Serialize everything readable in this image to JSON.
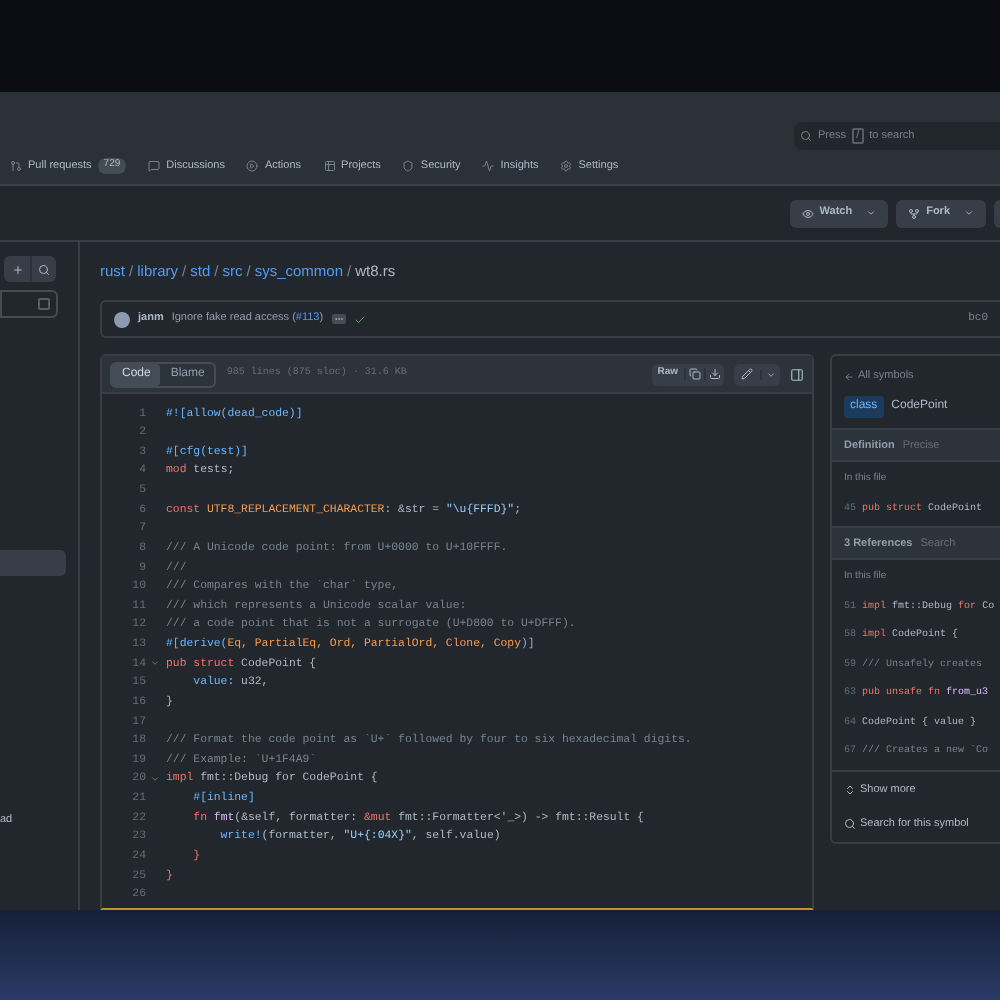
{
  "search": {
    "before": "Press",
    "key": "/",
    "after": "to search"
  },
  "repo_tabs": [
    {
      "label": "Pull requests",
      "count": "729"
    },
    {
      "label": "Discussions"
    },
    {
      "label": "Actions"
    },
    {
      "label": "Projects"
    },
    {
      "label": "Security"
    },
    {
      "label": "Insights"
    },
    {
      "label": "Settings"
    }
  ],
  "repo_actions": [
    {
      "label": "Watch"
    },
    {
      "label": "Fork"
    }
  ],
  "sidebar": {
    "items": [
      {
        "selected": true
      },
      {
        "label": "ad",
        "selected": false
      }
    ]
  },
  "breadcrumb": [
    {
      "text": "rust",
      "kind": "link"
    },
    {
      "text": "/",
      "kind": "sep"
    },
    {
      "text": "library",
      "kind": "link"
    },
    {
      "text": "/",
      "kind": "sep"
    },
    {
      "text": "std",
      "kind": "link"
    },
    {
      "text": "/",
      "kind": "sep"
    },
    {
      "text": "src",
      "kind": "link"
    },
    {
      "text": "/",
      "kind": "sep"
    },
    {
      "text": "sys_common",
      "kind": "link"
    },
    {
      "text": "/",
      "kind": "sep"
    },
    {
      "text": "wt8.rs",
      "kind": "file"
    }
  ],
  "commit": {
    "author": "janm",
    "message_before": "Ignore fake read access (",
    "link": "#113",
    "message_after": ")",
    "checks_passed": true,
    "sha": "bc0"
  },
  "file_header": {
    "tabs": [
      {
        "label": "Code",
        "selected": true
      },
      {
        "label": "Blame",
        "selected": false
      }
    ],
    "info": "985 lines (875 sloc) · 31.6 KB",
    "raw": "Raw"
  },
  "code": [
    {
      "number": "1",
      "fold": false,
      "tokens": [
        {
          "text": "#![allow(dead_code)]",
          "kind": "attr"
        }
      ]
    },
    {
      "number": "2",
      "fold": false
    },
    {
      "number": "3",
      "fold": false,
      "tokens": [
        {
          "text": "#[cfg(test)]",
          "kind": "attr"
        }
      ]
    },
    {
      "number": "4",
      "fold": false,
      "tokens": [
        {
          "text": "mod",
          "kind": "kw"
        },
        {
          "text": " tests;",
          "kind": "plain"
        }
      ]
    },
    {
      "number": "5",
      "fold": false
    },
    {
      "number": "6",
      "fold": false,
      "tokens": [
        {
          "text": "const ",
          "kind": "kw"
        },
        {
          "text": "UTF8_REPLACEMENT_CHARACTER",
          "kind": "const"
        },
        {
          "text": ": &str = ",
          "kind": "plain"
        },
        {
          "text": "\"\\u{FFFD}\"",
          "kind": "str"
        },
        {
          "text": ";",
          "kind": "plain"
        }
      ]
    },
    {
      "number": "7",
      "fold": false
    },
    {
      "number": "8",
      "fold": false,
      "tokens": [
        {
          "text": "/// A Unicode code point: from U+0000 to U+10FFFF.",
          "kind": "comment"
        }
      ]
    },
    {
      "number": "9",
      "fold": false,
      "tokens": [
        {
          "text": "///",
          "kind": "comment"
        }
      ]
    },
    {
      "number": "10",
      "fold": false,
      "tokens": [
        {
          "text": "/// Compares with the `char` type,",
          "kind": "comment"
        }
      ]
    },
    {
      "number": "11",
      "fold": false,
      "tokens": [
        {
          "text": "/// which represents a Unicode scalar value:",
          "kind": "comment"
        }
      ]
    },
    {
      "number": "12",
      "fold": false,
      "tokens": [
        {
          "text": "/// a code point that is not a surrogate (U+D800 to U+DFFF).",
          "kind": "comment"
        }
      ]
    },
    {
      "number": "13",
      "fold": false,
      "tokens": [
        {
          "text": "#[derive(",
          "kind": "attr"
        },
        {
          "text": "Eq, PartialEq, Ord, PartialOrd, Clone, Copy",
          "kind": "const"
        },
        {
          "text": ")]",
          "kind": "attr"
        }
      ]
    },
    {
      "number": "14",
      "fold": true,
      "tokens": [
        {
          "text": "pub struct",
          "kind": "kw"
        },
        {
          "text": " CodePoint {",
          "kind": "plain"
        }
      ]
    },
    {
      "number": "15",
      "fold": false,
      "tokens": [
        {
          "text": "    value",
          "kind": "attr"
        },
        {
          "text": ": u32,",
          "kind": "plain"
        }
      ]
    },
    {
      "number": "16",
      "fold": false,
      "tokens": [
        {
          "text": "}",
          "kind": "plain"
        }
      ]
    },
    {
      "number": "17",
      "fold": false
    },
    {
      "number": "18",
      "fold": false,
      "tokens": [
        {
          "text": "/// Format the code point as `U+` followed by four to six hexadecimal digits.",
          "kind": "comment"
        }
      ]
    },
    {
      "number": "19",
      "fold": false,
      "tokens": [
        {
          "text": "/// Example: `U+1F4A9`",
          "kind": "comment"
        }
      ]
    },
    {
      "number": "20",
      "fold": true,
      "tokens": [
        {
          "text": "impl",
          "kind": "kw"
        },
        {
          "text": " fmt::Debug for CodePoint {",
          "kind": "plain"
        }
      ]
    },
    {
      "number": "21",
      "fold": false,
      "tokens": [
        {
          "text": "    #[inline]",
          "kind": "attr"
        }
      ]
    },
    {
      "number": "22",
      "fold": false,
      "tokens": [
        {
          "text": "    fn ",
          "kind": "kw"
        },
        {
          "text": "fmt",
          "kind": "func"
        },
        {
          "text": "(&self, formatter: ",
          "kind": "plain"
        },
        {
          "text": "&mut",
          "kind": "kw"
        },
        {
          "text": " fmt::Formatter<'_>) -> fmt::Result {",
          "kind": "plain"
        }
      ]
    },
    {
      "number": "23",
      "fold": false,
      "tokens": [
        {
          "text": "        write!",
          "kind": "attr"
        },
        {
          "text": "(formatter, ",
          "kind": "plain"
        },
        {
          "text": "\"U+{:04X}\"",
          "kind": "str"
        },
        {
          "text": ", self.value)",
          "kind": "plain"
        }
      ]
    },
    {
      "number": "24",
      "fold": false,
      "tokens": [
        {
          "text": "    }",
          "kind": "kw"
        }
      ]
    },
    {
      "number": "25",
      "fold": false,
      "tokens": [
        {
          "text": "}",
          "kind": "kw"
        }
      ]
    },
    {
      "number": "26",
      "fold": false
    }
  ],
  "symbols": {
    "back": "All symbols",
    "badge": "class",
    "name": "CodePoint",
    "definition": {
      "title": "Definition",
      "subtitle": "Precise",
      "section": "In this file",
      "rows": [
        {
          "number": "45",
          "tokens": [
            {
              "text": "pub struct",
              "kind": "kw"
            },
            {
              "text": " CodePoint",
              "kind": "plain"
            }
          ]
        }
      ]
    },
    "references": {
      "title": "3 References",
      "subtitle": "Search",
      "section": "In this file",
      "rows": [
        {
          "number": "51",
          "tokens": [
            {
              "text": "impl",
              "kind": "kw"
            },
            {
              "text": " fmt::Debug ",
              "kind": "plain"
            },
            {
              "text": "for",
              "kind": "kw"
            },
            {
              "text": " Co",
              "kind": "plain"
            }
          ]
        },
        {
          "number": "58",
          "tokens": [
            {
              "text": "impl",
              "kind": "kw"
            },
            {
              "text": " CodePoint {",
              "kind": "plain"
            }
          ]
        },
        {
          "number": "59",
          "tokens": [
            {
              "text": "/// Unsafely creates",
              "kind": "comment"
            }
          ]
        },
        {
          "number": "63",
          "tokens": [
            {
              "text": "pub unsafe fn ",
              "kind": "kw"
            },
            {
              "text": "from_u3",
              "kind": "func"
            }
          ]
        },
        {
          "number": "64",
          "tokens": [
            {
              "text": "CodePoint { value }",
              "kind": "plain"
            }
          ]
        },
        {
          "number": "67",
          "tokens": [
            {
              "text": "/// Creates a new `Co",
              "kind": "comment"
            }
          ]
        }
      ]
    },
    "show_more": "Show more",
    "search_symbol": "Search for this symbol"
  }
}
